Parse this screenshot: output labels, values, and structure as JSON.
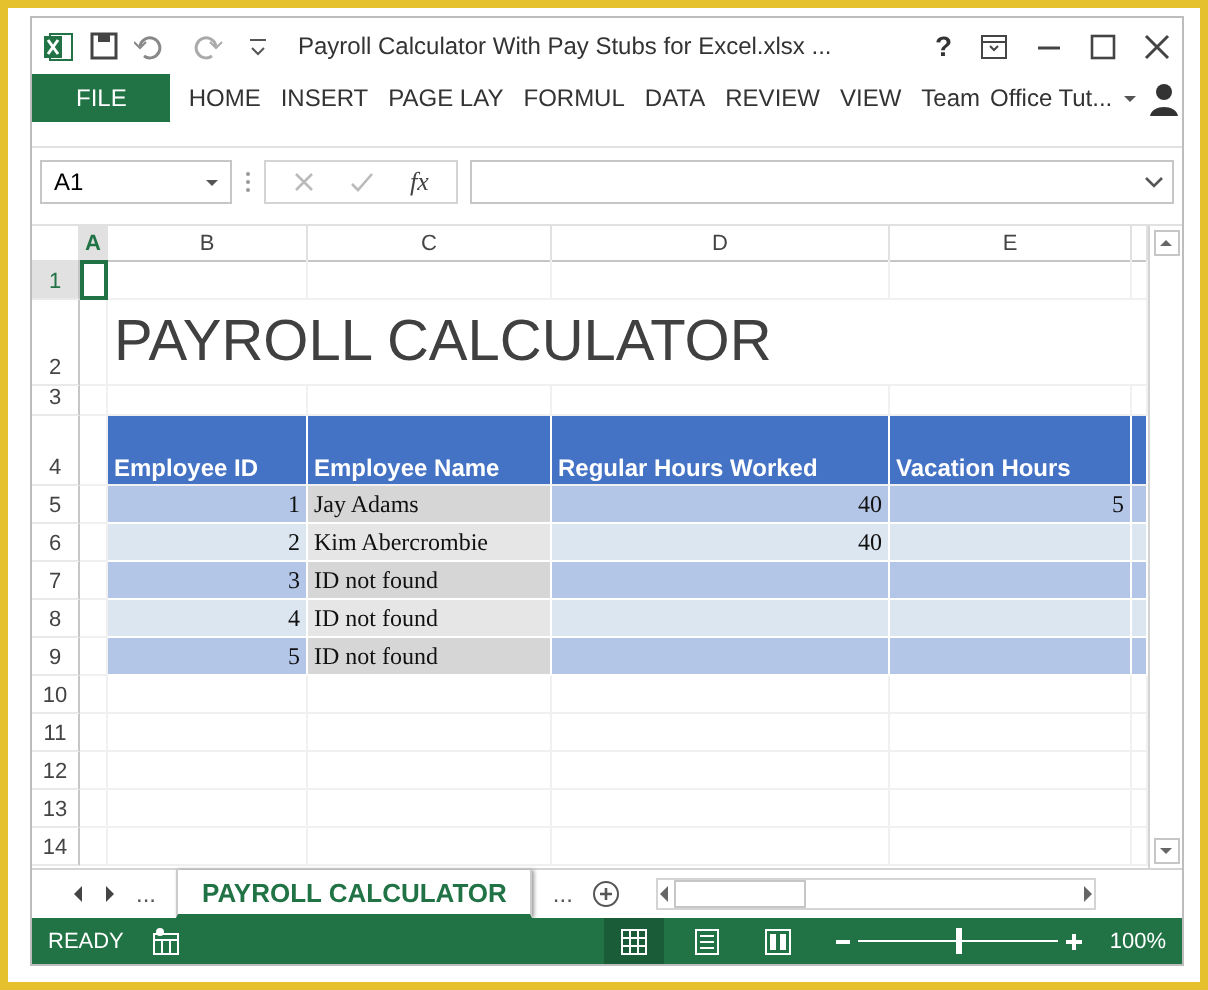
{
  "window": {
    "title": "Payroll Calculator With Pay Stubs for Excel.xlsx ...",
    "help": "?"
  },
  "ribbon_tabs": [
    {
      "label": "FILE",
      "kind": "file"
    },
    {
      "label": "HOME",
      "kind": "tab"
    },
    {
      "label": "INSERT",
      "kind": "tab"
    },
    {
      "label": "PAGE LAY",
      "kind": "tab"
    },
    {
      "label": "FORMUL",
      "kind": "tab"
    },
    {
      "label": "DATA",
      "kind": "tab"
    },
    {
      "label": "REVIEW",
      "kind": "tab"
    },
    {
      "label": "VIEW",
      "kind": "tab"
    },
    {
      "label": "Team",
      "kind": "tab"
    }
  ],
  "account": {
    "name": "Office Tut..."
  },
  "formula_bar": {
    "name_box": "A1",
    "function_label": "fx"
  },
  "sheet": {
    "columns": [
      {
        "label": "A",
        "selected": true
      },
      {
        "label": "B",
        "selected": false
      },
      {
        "label": "C",
        "selected": false
      },
      {
        "label": "D",
        "selected": false
      },
      {
        "label": "E",
        "selected": false
      }
    ],
    "rows": [
      {
        "label": "1",
        "selected": true
      },
      {
        "label": "2",
        "selected": false
      },
      {
        "label": "3",
        "selected": false
      },
      {
        "label": "4",
        "selected": false
      },
      {
        "label": "5",
        "selected": false
      },
      {
        "label": "6",
        "selected": false
      },
      {
        "label": "7",
        "selected": false
      },
      {
        "label": "8",
        "selected": false
      },
      {
        "label": "9",
        "selected": false
      },
      {
        "label": "10",
        "selected": false
      },
      {
        "label": "11",
        "selected": false
      },
      {
        "label": "12",
        "selected": false
      },
      {
        "label": "13",
        "selected": false
      },
      {
        "label": "14",
        "selected": false
      }
    ],
    "title": "PAYROLL CALCULATOR",
    "table": {
      "headers": [
        "Employee ID",
        "Employee Name",
        "Regular Hours Worked",
        "Vacation Hours"
      ],
      "rows": [
        {
          "id": "1",
          "name": "Jay Adams",
          "regular_hours": "40",
          "vacation_hours": "5"
        },
        {
          "id": "2",
          "name": "Kim Abercrombie",
          "regular_hours": "40"
        },
        {
          "id": "3",
          "name": "ID not found"
        },
        {
          "id": "4",
          "name": "ID not found"
        },
        {
          "id": "5",
          "name": "ID not found"
        }
      ]
    }
  },
  "sheet_tabs": {
    "more_left": "...",
    "more_right": "...",
    "tabs": [
      {
        "label": "PAYROLL CALCULATOR",
        "selected": true
      }
    ]
  },
  "status_bar": {
    "status": "READY",
    "views": [
      {
        "kind": "normal",
        "selected": true
      },
      {
        "kind": "page-layout",
        "selected": false
      },
      {
        "kind": "page-break",
        "selected": false
      }
    ],
    "zoom": {
      "level": 0.5,
      "reading": "100%"
    }
  }
}
